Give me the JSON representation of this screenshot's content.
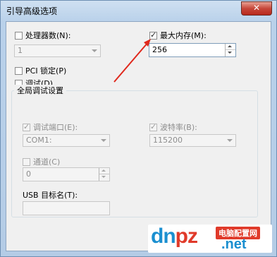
{
  "window": {
    "title": "引导高级选项",
    "close_label": "✕"
  },
  "processors": {
    "label": "处理器数(N):",
    "checked": false,
    "value": "1"
  },
  "max_memory": {
    "label": "最大内存(M):",
    "checked": true,
    "value": "256"
  },
  "pci_lock": {
    "label": "PCI 锁定(P)",
    "checked": false
  },
  "debug": {
    "label": "调试(D)",
    "checked": false
  },
  "global_debug": {
    "title": "全局调试设置",
    "debug_port": {
      "label": "调试端口(E):",
      "checked": true,
      "value": "COM1:"
    },
    "baud_rate": {
      "label": "波特率(B):",
      "checked": true,
      "value": "115200"
    },
    "channel": {
      "label": "通道(C)",
      "checked": false,
      "value": "0"
    },
    "usb_target": {
      "label": "USB 目标名(T):",
      "value": ""
    }
  },
  "annotation": {
    "arrow_color": "#e0281c"
  },
  "watermark": {
    "logo_d": "d",
    "logo_n": "n",
    "logo_pz": "pz",
    "cn_text": "电脑配置网",
    "net": ".net"
  },
  "colors": {
    "accent": "#1a8fd0",
    "brand_red": "#e03a2a"
  }
}
